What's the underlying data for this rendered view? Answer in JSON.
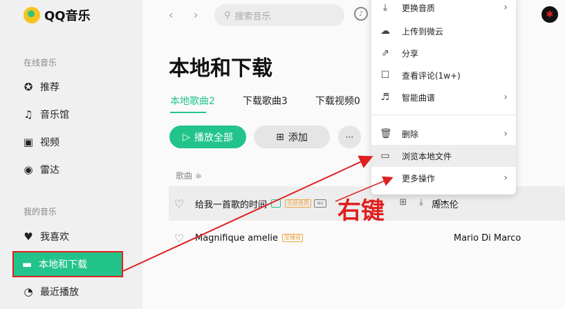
{
  "app": {
    "name": "QQ音乐"
  },
  "sidebar": {
    "online_label": "在线音乐",
    "my_label": "我的音乐",
    "items": [
      {
        "label": "推荐",
        "icon": "star-circle-icon"
      },
      {
        "label": "音乐馆",
        "icon": "music-note-icon"
      },
      {
        "label": "视频",
        "icon": "video-icon"
      },
      {
        "label": "雷达",
        "icon": "radar-icon"
      },
      {
        "label": "我喜欢",
        "icon": "heart-icon"
      },
      {
        "label": "本地和下载",
        "icon": "monitor-icon"
      },
      {
        "label": "最近播放",
        "icon": "clock-icon"
      }
    ]
  },
  "topbar": {
    "search_placeholder": "搜索音乐"
  },
  "page": {
    "title": "本地和下载",
    "tabs": [
      "本地歌曲2",
      "下载歌曲3",
      "下载视频0"
    ],
    "play_all": "播放全部",
    "add": "添加",
    "more": "···",
    "col_song": "歌曲 ≑"
  },
  "songs": [
    {
      "title": "给我一首歌的时间",
      "artist": "周杰伦",
      "tags": [
        "",
        "无损音质"
      ],
      "mv": "MV"
    },
    {
      "title": "Magnifique amelie",
      "artist": "Mario Di Marco",
      "tags": [
        "至臻音"
      ]
    }
  ],
  "context_menu": {
    "items": [
      {
        "label": "更换音质",
        "icon": "download-icon",
        "submenu": true
      },
      {
        "label": "上传到微云",
        "icon": "cloud-icon",
        "submenu": false
      },
      {
        "label": "分享",
        "icon": "share-icon",
        "submenu": false
      },
      {
        "label": "查看评论(1w+)",
        "icon": "comment-icon",
        "submenu": false
      },
      {
        "label": "智能曲谱",
        "icon": "score-icon",
        "submenu": true
      },
      {
        "label": "删除",
        "icon": "trash-icon",
        "submenu": true
      },
      {
        "label": "浏览本地文件",
        "icon": "folder-icon",
        "submenu": false
      },
      {
        "label": "更多操作",
        "icon": "",
        "submenu": true
      }
    ]
  },
  "annotation": {
    "text": "右键"
  },
  "colors": {
    "accent": "#22c48b",
    "annotation": "#e02020"
  }
}
